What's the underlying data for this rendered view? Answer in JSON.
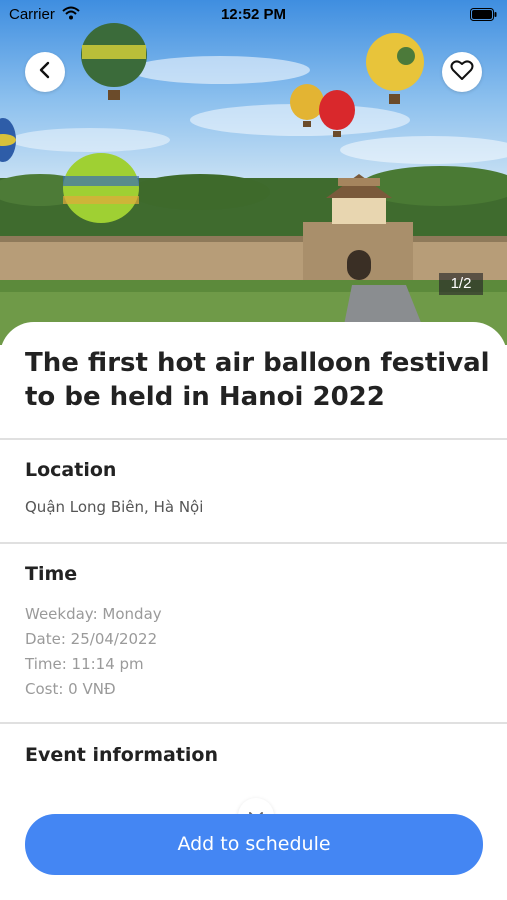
{
  "status_bar": {
    "carrier": "Carrier",
    "time": "12:52 PM"
  },
  "hero": {
    "page_indicator": "1/2"
  },
  "event": {
    "title": "The first hot air balloon festival to be held in Hanoi 2022"
  },
  "location": {
    "heading": "Location",
    "value": "Quận Long Biên, Hà Nội"
  },
  "time_section": {
    "heading": "Time",
    "weekday": "Weekday: Monday",
    "date": "Date: 25/04/2022",
    "time": "Time: 11:14 pm",
    "cost": "Cost: 0 VNĐ"
  },
  "info": {
    "heading": "Event information"
  },
  "actions": {
    "add_label": "Add to schedule"
  },
  "colors": {
    "primary": "#4486f3",
    "divider": "#e0e0e0"
  },
  "icons": [
    "back-arrow-icon",
    "heart-icon",
    "wifi-icon",
    "battery-icon",
    "chevron-down-icon"
  ]
}
